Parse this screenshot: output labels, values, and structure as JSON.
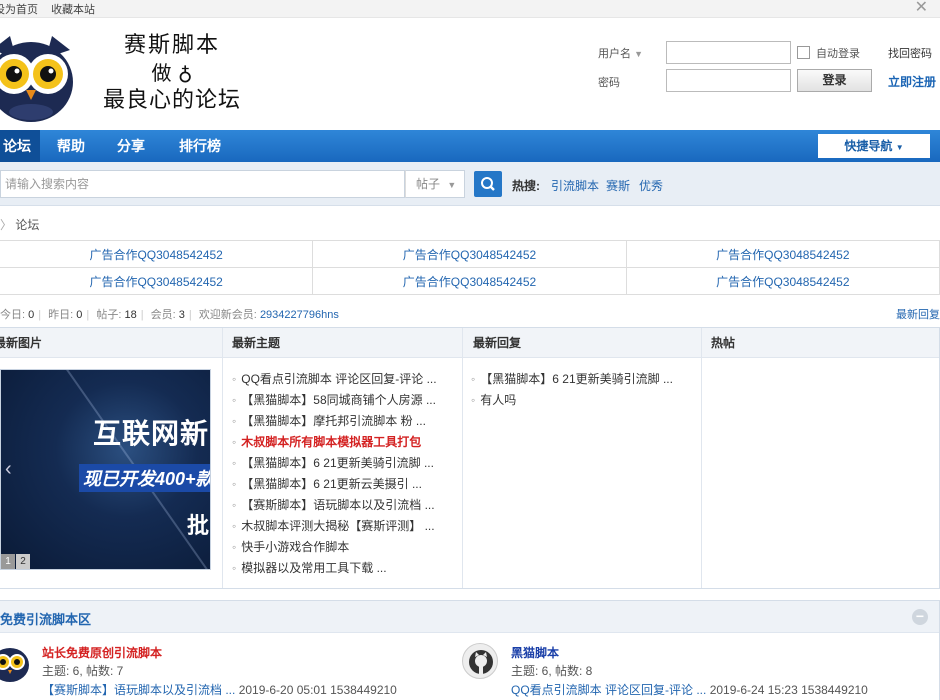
{
  "topbar": {
    "set_home": "设为首页",
    "bookmark": "收藏本站"
  },
  "logo": {
    "line1": "赛斯脚本",
    "line2": "做",
    "line3": "最良心的论坛"
  },
  "login": {
    "username_label": "用户名",
    "password_label": "密码",
    "auto_login": "自动登录",
    "find_password": "找回密码",
    "login_button": "登录",
    "register": "立即注册"
  },
  "nav": {
    "items": [
      {
        "label": "论坛"
      },
      {
        "label": "帮助"
      },
      {
        "label": "分享"
      },
      {
        "label": "排行榜"
      }
    ],
    "quick_nav": "快捷导航"
  },
  "search": {
    "placeholder": "请输入搜索内容",
    "type": "帖子",
    "hot_label": "热搜:",
    "hot": [
      "引流脚本",
      "赛斯",
      "优秀"
    ]
  },
  "breadcrumb": {
    "current": "论坛"
  },
  "ads": {
    "rows": [
      [
        "广告合作QQ3048542452",
        "广告合作QQ3048542452",
        "广告合作QQ3048542452"
      ],
      [
        "广告合作QQ3048542452",
        "广告合作QQ3048542452",
        "广告合作QQ3048542452"
      ]
    ]
  },
  "stats": {
    "today_label": "今日:",
    "today": "0",
    "yesterday_label": "昨日:",
    "yesterday": "0",
    "posts_label": "帖子:",
    "posts": "18",
    "members_label": "会员:",
    "members": "3",
    "welcome_label": "欢迎新会员:",
    "new_member": "2934227796hns",
    "latest_reply_link": "最新回复"
  },
  "main": {
    "col_titles": {
      "images": "最新图片",
      "topics": "最新主题",
      "replies": "最新回复",
      "hot": "热帖"
    },
    "slide": {
      "line1": "互联网新",
      "line2": "现已开发400+款",
      "line3": "批",
      "dots": [
        "1",
        "2"
      ]
    },
    "topics": [
      "QQ看点引流脚本 评论区回复-评论 ...",
      "【黑猫脚本】58同城商铺个人房源 ...",
      "【黑猫脚本】摩托邦引流脚本 粉 ...",
      "木叔脚本所有脚本模拟器工具打包",
      "【黑猫脚本】6 21更新美骑引流脚 ...",
      "【黑猫脚本】6 21更新云美摄引 ...",
      "【赛斯脚本】语玩脚本以及引流档 ...",
      "木叔脚本评测大揭秘【赛斯评测】 ...",
      "快手小游戏合作脚本",
      "模拟器以及常用工具下载 ..."
    ],
    "replies": [
      "【黑猫脚本】6 21更新美骑引流脚 ...",
      "有人吗"
    ]
  },
  "section": {
    "title": "免费引流脚本区",
    "forums": [
      {
        "name": "站长免费原创引流脚本",
        "stat": "主题: 6, 帖数: 7",
        "last_title": "【赛斯脚本】语玩脚本以及引流档 ...",
        "last_time": "2019-6-20 05:01",
        "last_user": "1538449210"
      },
      {
        "name": "黑猫脚本",
        "stat": "主题: 6, 帖数: 8",
        "last_title": "QQ看点引流脚本 评论区回复-评论 ...",
        "last_time": "2019-6-24 15:23",
        "last_user": "1538449210"
      }
    ]
  }
}
